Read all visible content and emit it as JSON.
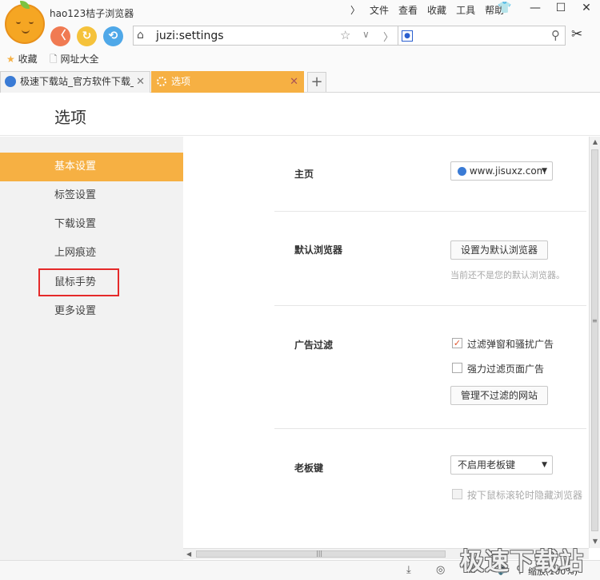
{
  "app": {
    "title": "hao123桔子浏览器"
  },
  "menu": [
    "文件",
    "查看",
    "收藏",
    "工具",
    "帮助"
  ],
  "window_controls": {
    "chevron": "〉",
    "skin": "👕",
    "minimize": "—",
    "maximize": "☐",
    "close": "✕"
  },
  "nav": {
    "back": "〈",
    "refresh": "↻",
    "undo": "⟲"
  },
  "address_bar": {
    "url": "juzi:settings",
    "home_icon": "⌂",
    "star_icon": "☆",
    "dropdown_icon": "∨",
    "forward_icon": "〉"
  },
  "search": {
    "engine_icon": "🐾",
    "value": "",
    "search_icon": "⚲"
  },
  "toolbar": {
    "scissors_icon": "✂"
  },
  "favorites": [
    {
      "icon": "★",
      "label": "收藏"
    },
    {
      "icon": "🗋",
      "label": "网址大全"
    }
  ],
  "tabs": [
    {
      "label": "极速下载站_官方软件下载_绿",
      "close": "✕",
      "active": false
    },
    {
      "label": "选项",
      "close": "✕",
      "active": true
    }
  ],
  "new_tab": "+",
  "page_title": "选项",
  "sidebar": {
    "items": [
      {
        "label": "基本设置",
        "active": true
      },
      {
        "label": "标签设置",
        "active": false
      },
      {
        "label": "下载设置",
        "active": false
      },
      {
        "label": "上网痕迹",
        "active": false
      },
      {
        "label": "鼠标手势",
        "active": false,
        "highlighted": true
      },
      {
        "label": "更多设置",
        "active": false
      }
    ]
  },
  "settings": {
    "homepage": {
      "label": "主页",
      "value": "www.jisuxz.com",
      "caret": "▼"
    },
    "default_browser": {
      "label": "默认浏览器",
      "button": "设置为默认浏览器",
      "hint": "当前还不是您的默认浏览器。"
    },
    "ad_filter": {
      "label": "广告过滤",
      "options": [
        {
          "label": "过滤弹窗和骚扰广告",
          "checked": true
        },
        {
          "label": "强力过滤页面广告",
          "checked": false
        }
      ],
      "button": "管理不过滤的网站"
    },
    "boss_key": {
      "label": "老板键",
      "value": "不启用老板键",
      "caret": "▼",
      "option": {
        "label": "按下鼠标滚轮时隐藏浏览器",
        "checked": false,
        "disabled": true
      }
    }
  },
  "scrollbar": {
    "up": "▲",
    "down": "▼",
    "grip": "≡",
    "left": "◀",
    "hgrip": "|||"
  },
  "statusbar": {
    "download_icon": "⤓",
    "icon2": "◎",
    "icon3": "⧉",
    "icon4": "🔈",
    "zoom_icon": "⚲",
    "zoom": "缩放(100%)"
  },
  "watermark": "极速下载站",
  "colors": {
    "accent": "#f6b043",
    "highlight_border": "#e52a2a"
  }
}
